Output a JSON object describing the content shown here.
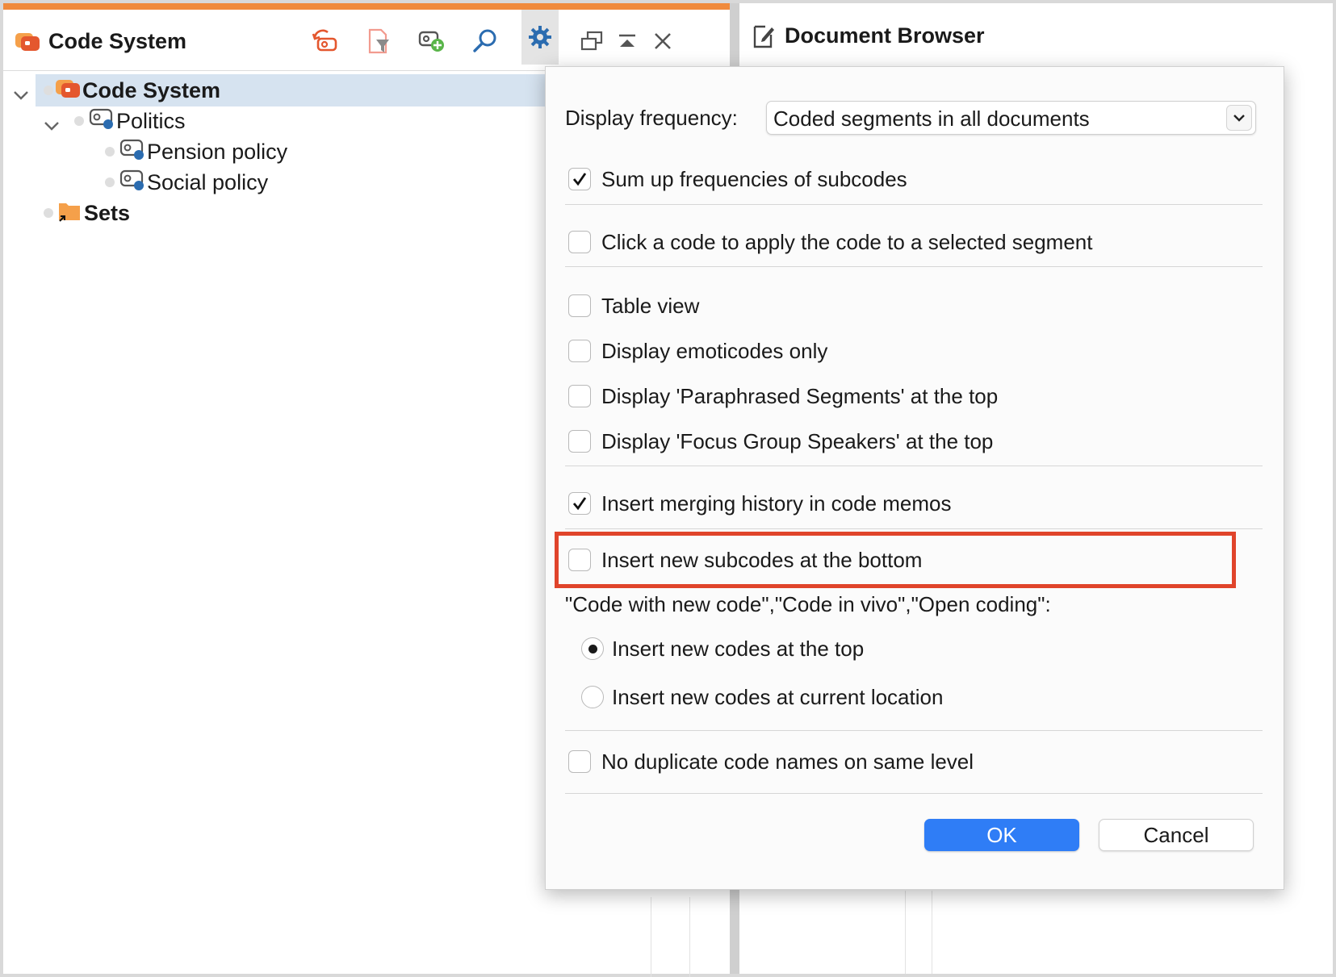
{
  "code_system_panel": {
    "title": "Code System",
    "toolbar_icons": [
      "reset-code-icon",
      "filter-icon",
      "new-code-icon",
      "search-icon",
      "gear-icon",
      "undock-icon",
      "collapse-up-icon",
      "close-icon"
    ],
    "tree": [
      {
        "label": "Code System",
        "level": 0,
        "expanded": true,
        "selected": true,
        "icon": "code-system-icon"
      },
      {
        "label": "Politics",
        "level": 1,
        "expanded": true,
        "icon": "code-icon",
        "color": "#2b6cb0"
      },
      {
        "label": "Pension policy",
        "level": 2,
        "icon": "code-icon",
        "color": "#2b6cb0"
      },
      {
        "label": "Social policy",
        "level": 2,
        "icon": "code-icon",
        "color": "#2b6cb0"
      },
      {
        "label": "Sets",
        "level": 1,
        "icon": "folder-icon",
        "color": "#f5a04a"
      }
    ]
  },
  "document_browser_panel": {
    "title": "Document Browser",
    "icon": "edit-document-icon"
  },
  "settings_dialog": {
    "display_frequency_label": "Display frequency:",
    "display_frequency_value": "Coded segments in all documents",
    "options": {
      "sum_up": {
        "label": "Sum up frequencies of subcodes",
        "checked": true
      },
      "click_apply": {
        "label": "Click a code to apply the code to a selected segment",
        "checked": false
      },
      "table_view": {
        "label": "Table view",
        "checked": false
      },
      "emoticodes": {
        "label": "Display emoticodes only",
        "checked": false
      },
      "paraphrased": {
        "label": "Display 'Paraphrased Segments' at the top",
        "checked": false
      },
      "focus_group": {
        "label": "Display 'Focus Group Speakers' at the top",
        "checked": false
      },
      "merging_history": {
        "label": "Insert merging history in code memos",
        "checked": true
      },
      "subcodes_bottom": {
        "label": "Insert new subcodes at the bottom",
        "checked": false,
        "highlighted": true
      },
      "no_duplicates": {
        "label": "No duplicate code names on same level",
        "checked": false
      }
    },
    "new_code_group_label": "\"Code with new code\",\"Code in vivo\",\"Open coding\":",
    "radio_options": [
      {
        "label": "Insert new codes at the top",
        "selected": true
      },
      {
        "label": "Insert new codes at current location",
        "selected": false
      }
    ],
    "ok_label": "OK",
    "cancel_label": "Cancel"
  },
  "colors": {
    "accent_orange": "#f08a3c",
    "highlight_red": "#e0442b",
    "ok_blue": "#2f7df6",
    "selection_blue": "#d6e3f0"
  }
}
